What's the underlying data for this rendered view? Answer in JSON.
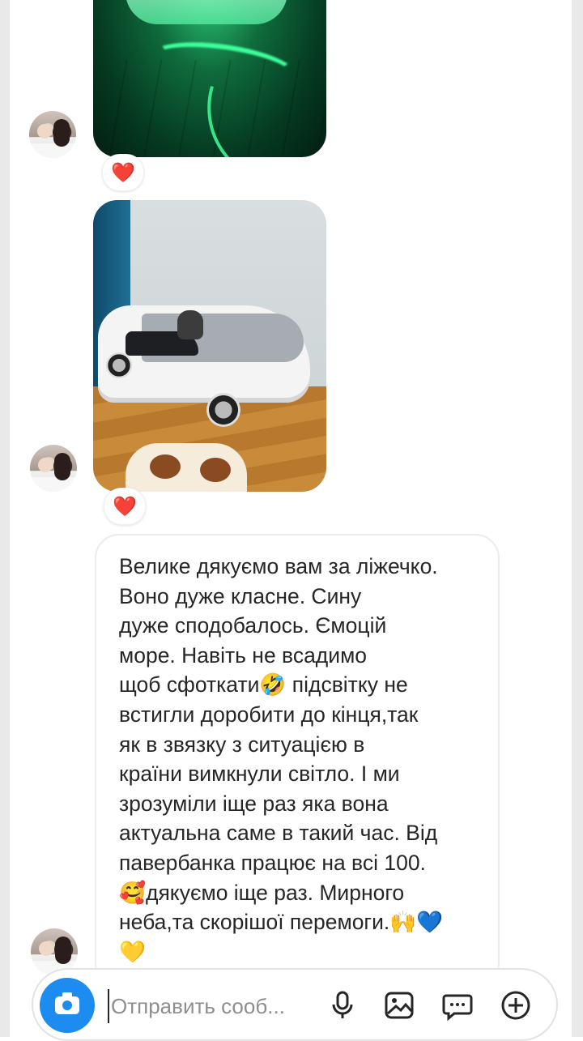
{
  "thread": {
    "reactions": [
      {
        "emoji": "❤️"
      },
      {
        "emoji": "❤️"
      }
    ],
    "message": {
      "text": "Велике дякуємо вам за ліжечко.\nВоно дуже класне. Сину\nдуже сподобалось. Ємоцій\nморе. Навіть не всадимо\nщоб сфоткати🤣 підсвітку не\nвстигли доробити до кінця,так\nяк в звязку з ситуацією в\nкраїни вимкнули світло. І ми\nзрозуміли іще раз яка вона\nактуальна саме в такий час. Від\nпавербанка працює на всі 100.\n🥰дякуємо іще раз. Мирного\nнеба,та скорішої перемоги.🙌💙\n💛"
    }
  },
  "composer": {
    "placeholder": "Отправить сооб..."
  },
  "icons": {
    "camera": "camera-icon",
    "microphone": "microphone-icon",
    "gallery": "gallery-icon",
    "sticker": "sticker-icon",
    "add": "plus-icon"
  },
  "colors": {
    "accent": "#1d8cf0",
    "reaction": "#e0262b",
    "text": "#262626",
    "placeholder": "#8e8e8e"
  }
}
